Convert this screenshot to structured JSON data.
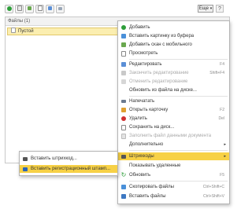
{
  "toolbar": {
    "buttons": [
      "add-icon",
      "add-file-icon",
      "scan-icon",
      "document-icon",
      "edit-icon",
      "print-icon"
    ],
    "more_label": "Еще",
    "help_label": "?"
  },
  "list": {
    "header": "Файлы (1)",
    "rows": [
      {
        "name": "Пустой"
      }
    ]
  },
  "menu": {
    "items": [
      {
        "label": "Добавить",
        "shortcut": "",
        "icon": "plus-icon"
      },
      {
        "label": "Вставить картинку из буфера",
        "shortcut": "",
        "icon": "clipboard-icon"
      },
      {
        "label": "Добавить скан с мобильного",
        "shortcut": "",
        "icon": "scan-icon"
      },
      {
        "label": "Просмотреть",
        "shortcut": "",
        "icon": "view-icon"
      },
      {
        "label": "Редактировать",
        "shortcut": "F4",
        "icon": "edit-icon"
      },
      {
        "label": "Закончить редактирование",
        "shortcut": "Shift+F4",
        "icon": "finish-edit-icon"
      },
      {
        "label": "Отменить редактирование",
        "shortcut": "",
        "icon": "cancel-edit-icon"
      },
      {
        "label": "Обновить из файла на диске...",
        "shortcut": "",
        "icon": ""
      },
      {
        "label": "Напечатать",
        "shortcut": "",
        "icon": "print-icon"
      },
      {
        "label": "Открыть карточку",
        "shortcut": "F2",
        "icon": "open-card-icon"
      },
      {
        "label": "Удалить",
        "shortcut": "Del",
        "icon": "delete-icon"
      },
      {
        "label": "Сохранить на диск...",
        "shortcut": "",
        "icon": "save-icon"
      },
      {
        "label": "Заполнить файл данными документа",
        "shortcut": "",
        "icon": "fill-icon"
      },
      {
        "label": "Дополнительно",
        "shortcut": "",
        "icon": ""
      },
      {
        "label": "Штрихкоды",
        "shortcut": "",
        "icon": "barcode-icon"
      },
      {
        "label": "Показывать удаленные",
        "shortcut": "",
        "icon": ""
      },
      {
        "label": "Обновить",
        "shortcut": "F5",
        "icon": "refresh-icon"
      },
      {
        "label": "Скопировать файлы",
        "shortcut": "Ctrl+Shift+C",
        "icon": "copy-icon"
      },
      {
        "label": "Вставить файлы",
        "shortcut": "Ctrl+Shift+V",
        "icon": "paste-icon"
      }
    ]
  },
  "submenu": {
    "items": [
      {
        "label": "Вставить штрихкод...",
        "icon": "barcode-icon"
      },
      {
        "label": "Вставить регистрационный штамп...",
        "icon": "stamp-icon"
      }
    ]
  },
  "colors": {
    "highlight": "#f7d146",
    "selected_row": "#fbeeb0",
    "add_green": "#2e9e3a",
    "delete_red": "#d03030",
    "accent_blue": "#2c66b8"
  }
}
